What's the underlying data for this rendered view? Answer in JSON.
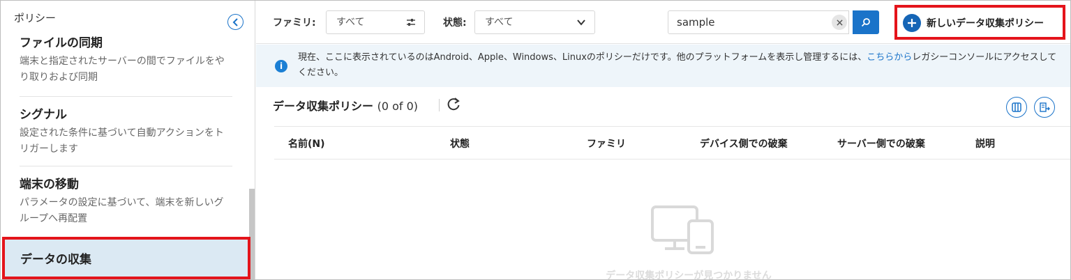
{
  "sidebar": {
    "title": "ポリシー",
    "items": [
      {
        "title": "ファイルの同期",
        "desc": "端末と指定されたサーバーの間でファイルをやり取りおよび同期"
      },
      {
        "title": "シグナル",
        "desc": "設定された条件に基づいて自動アクションをトリガーします"
      },
      {
        "title": "端末の移動",
        "desc": "パラメータの設定に基づいて、端末を新しいグループへ再配置"
      },
      {
        "title": "データの収集"
      }
    ]
  },
  "toolbar": {
    "family_label": "ファミリ:",
    "family_value": "すべて",
    "status_label": "状態:",
    "status_value": "すべて",
    "search_value": "sample",
    "new_button": "新しいデータ収集ポリシー"
  },
  "banner": {
    "text_before": "現在、ここに表示されているのはAndroid、Apple、Windows、Linuxのポリシーだけです。他のプラットフォームを表示し管理するには、",
    "link": "こちらから",
    "text_after": "レガシーコンソールにアクセスしてください。"
  },
  "list": {
    "title": "データ収集ポリシー",
    "count": "(0 of 0)",
    "columns": [
      "名前(N)",
      "状態",
      "ファミリ",
      "デバイス側での破棄",
      "サーバー側での破棄",
      "説明"
    ],
    "empty_text": "データ収集ポリシーが見つかりません"
  },
  "colors": {
    "accent": "#1a73c9",
    "highlight": "#e4141b",
    "active_bg": "#dbe9f3",
    "banner_bg": "#eef5fa"
  }
}
